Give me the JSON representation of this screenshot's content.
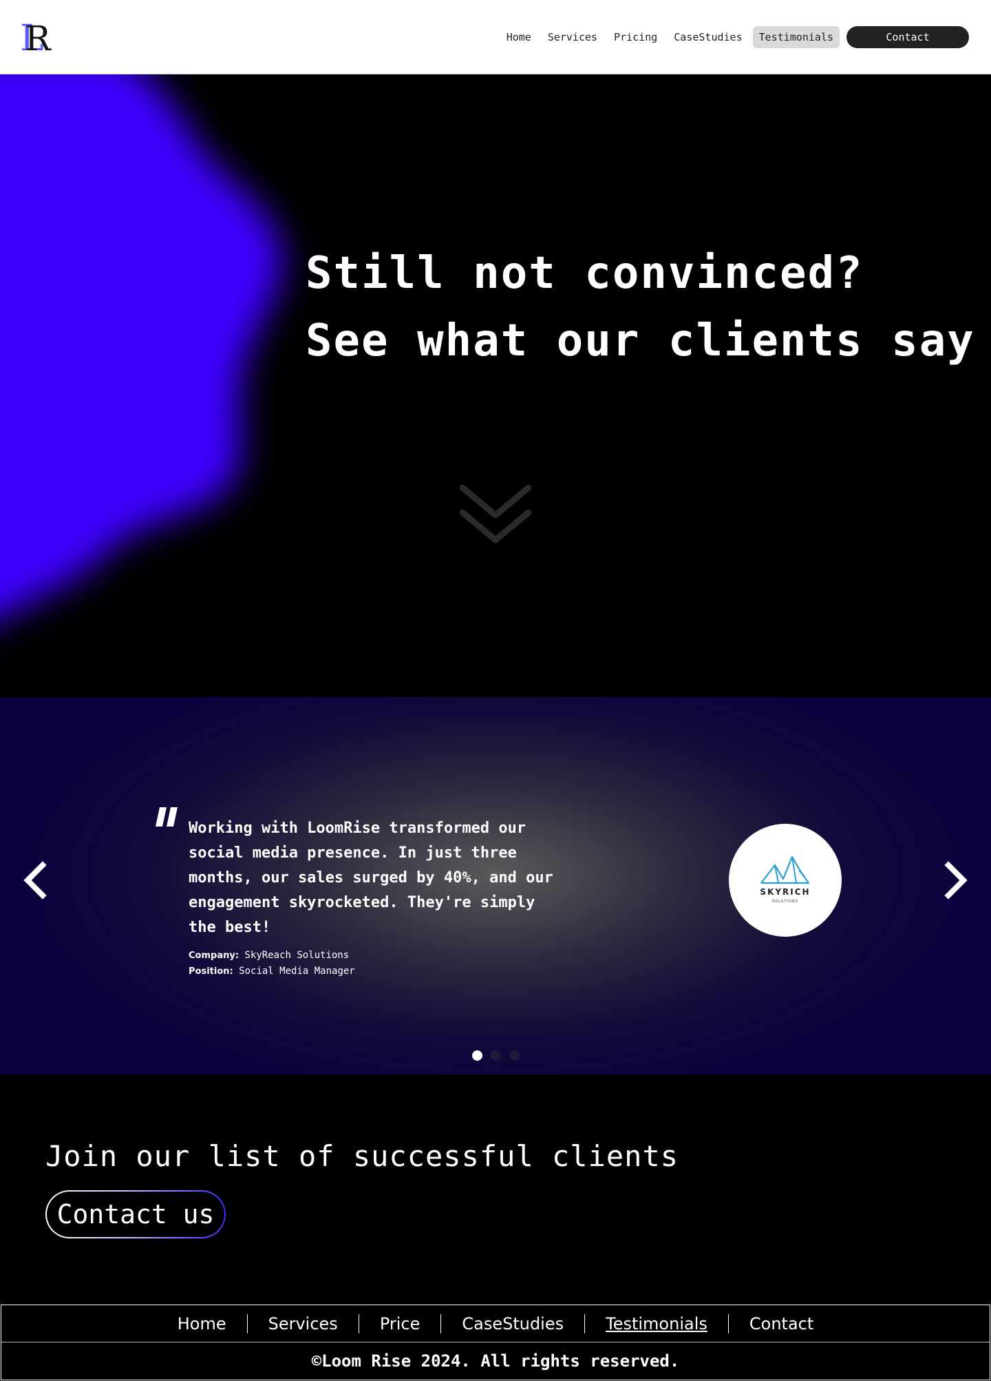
{
  "header": {
    "logo_letter": "R",
    "logo_icon": "loomrise-logo-icon",
    "nav": [
      {
        "label": "Home"
      },
      {
        "label": "Services"
      },
      {
        "label": "Pricing"
      },
      {
        "label": "CaseStudies"
      },
      {
        "label": "Testimonials"
      },
      {
        "label": "Contact"
      }
    ],
    "active_item": "Testimonials"
  },
  "hero": {
    "title_line1": "Still not convinced?",
    "title_line2": "See what our clients say",
    "scroll_icon": "double-chevron-down-icon"
  },
  "testimonial": {
    "quote": "Working with LoomRise transformed our social media presence. In just three months, our sales surged by 40%, and our engagement skyrocketed. They're simply the best!",
    "company_label": "Company:",
    "company": "SkyReach Solutions",
    "position_label": "Position:",
    "position": "Social Media Manager",
    "client_logo": {
      "icon": "mountain-logo-icon",
      "brand": "SKYRICH",
      "sub": "SOLUTIONS"
    },
    "prev_icon": "chevron-left-icon",
    "next_icon": "chevron-right-icon",
    "slide_count": 3,
    "active_slide": 1
  },
  "cta": {
    "title": "Join our list of successful clients",
    "button_label": "Contact us"
  },
  "footer": {
    "nav": [
      {
        "label": "Home"
      },
      {
        "label": "Services"
      },
      {
        "label": "Price"
      },
      {
        "label": "CaseStudies"
      },
      {
        "label": "Testimonials"
      },
      {
        "label": "Contact"
      }
    ],
    "current_item": "Testimonials",
    "copyright": "©Loom Rise 2024. All rights reserved."
  },
  "colors": {
    "brand_blue": "#3d00ff",
    "testimonial_bg": "#0a023d",
    "nav_active_bg": "#d9d9d9",
    "contact_pill_bg": "#222222",
    "client_logo_blue": "#2a9fd6"
  }
}
